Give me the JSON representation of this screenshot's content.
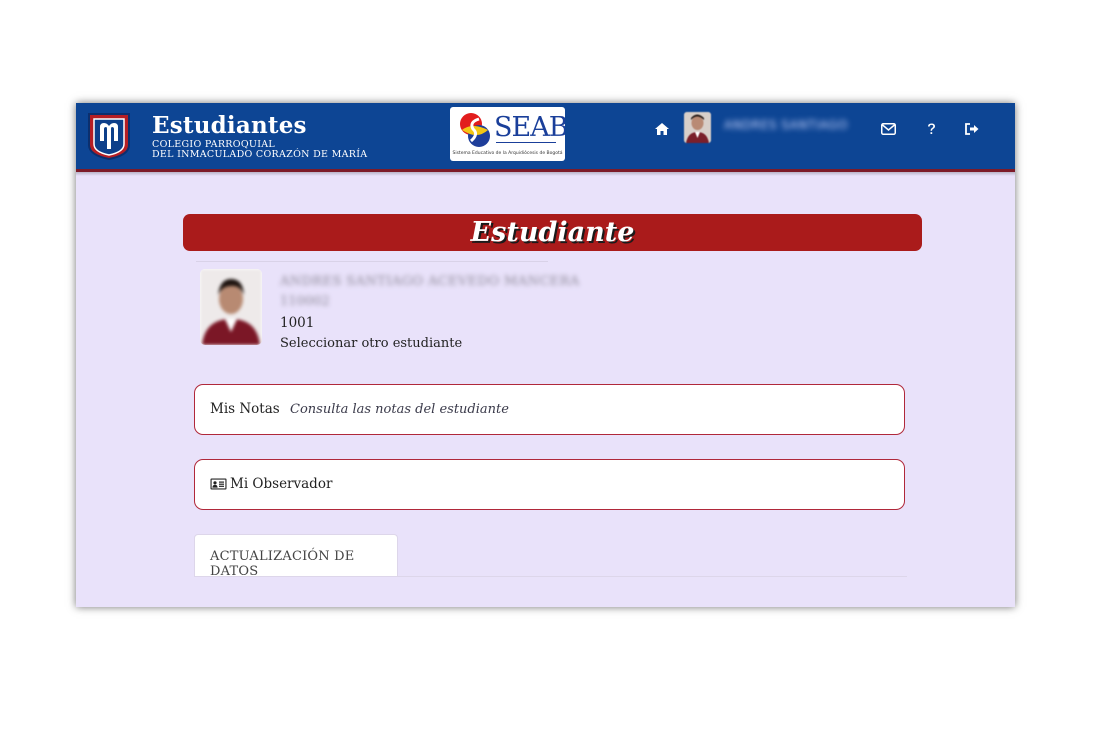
{
  "header": {
    "app_title": "Estudiantes",
    "school_line1": "COLEGIO PARROQUIAL",
    "school_line2": "DEL INMACULADO CORAZÓN DE MARÍA",
    "partner_logo_text": "SEAB",
    "partner_logo_caption": "Sistema Educativo de la Arquidiócesis de Bogotá",
    "username": "ANDRES SANTIAGO",
    "icons": [
      "home-icon",
      "envelope-icon",
      "question-icon",
      "sign-out-icon"
    ]
  },
  "section": {
    "title": "Estudiante"
  },
  "student": {
    "name": "ANDRES SANTIAGO ACEVEDO MANCERA",
    "code": "110002",
    "group": "1001",
    "select_other_label": "Seleccionar otro estudiante"
  },
  "cards": {
    "notas": {
      "label": "Mis Notas",
      "description": "Consulta las notas del estudiante"
    },
    "observador": {
      "icon": "id-card-icon",
      "label": "Mi Observador"
    }
  },
  "tabs": {
    "update_data": "ACTUALIZACIÓN DE DATOS"
  },
  "colors": {
    "topbar": "#0d4594",
    "accent_red": "#aa1b1b",
    "background": "#e9e2fa",
    "card_border": "#b0283a"
  }
}
